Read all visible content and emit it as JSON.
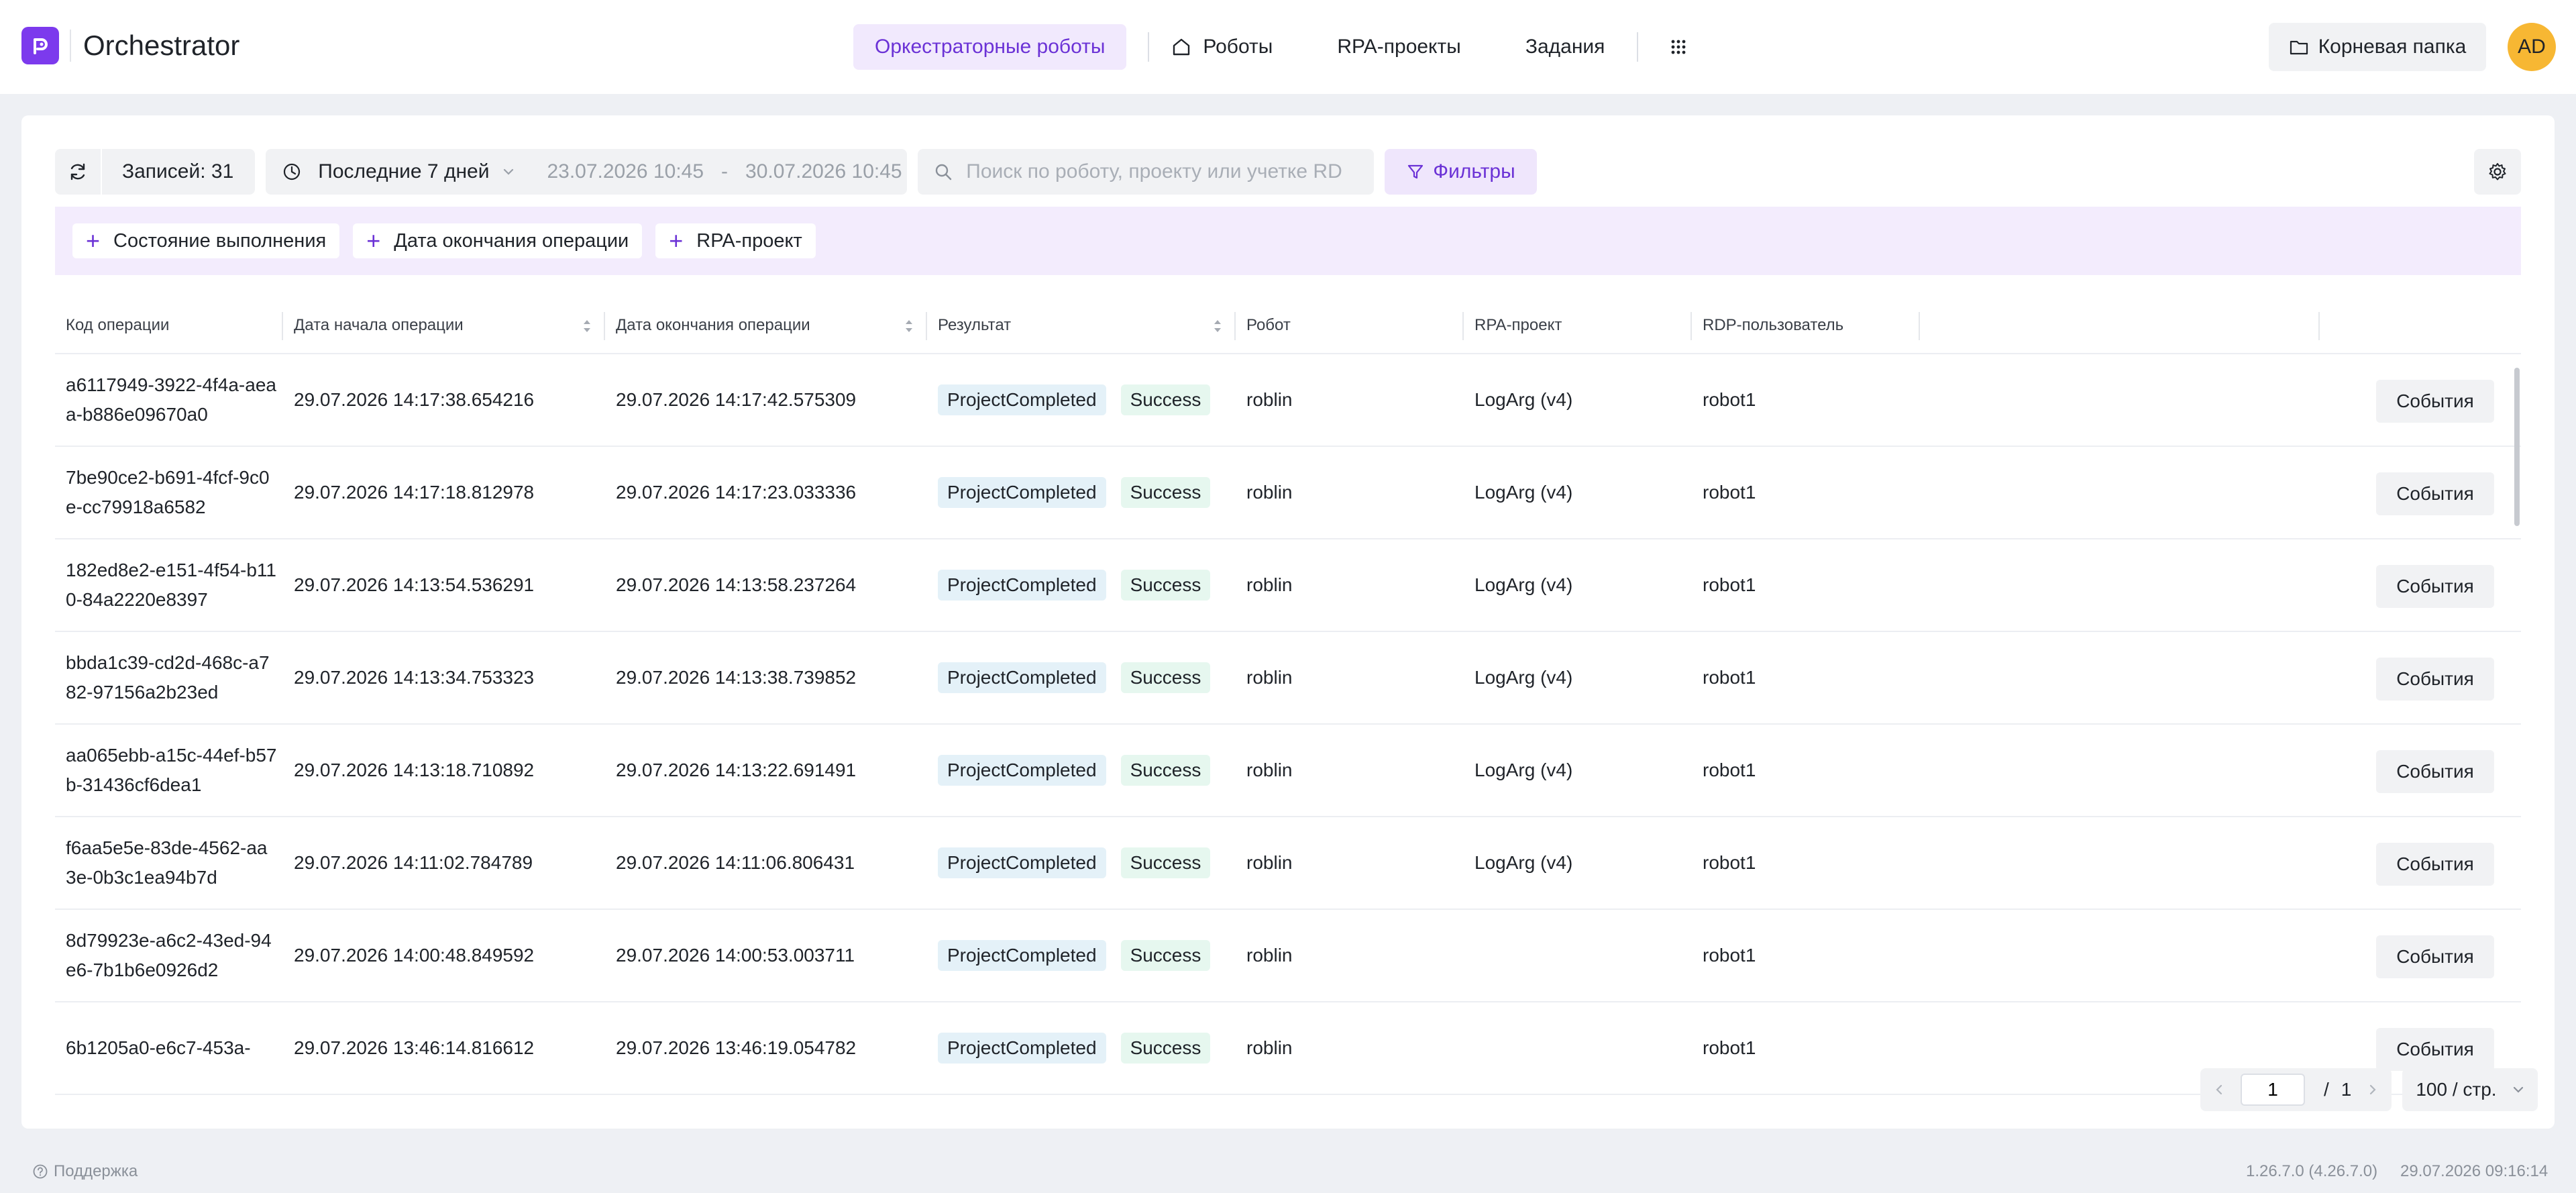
{
  "header": {
    "app_title": "Orchestrator",
    "nav_active": "Оркестраторные роботы",
    "nav_items": [
      "Роботы",
      "RPA-проекты",
      "Задания"
    ],
    "root_folder": "Корневая папка",
    "avatar_initials": "AD"
  },
  "toolbar": {
    "records": "Записей: 31",
    "range_label": "Последние 7 дней",
    "date_from": "23.07.2026 10:45",
    "date_to": "30.07.2026 10:45",
    "range_sep": "-",
    "search_placeholder": "Поиск по роботу, проекту или учетке RDP",
    "filters_label": "Фильтры"
  },
  "filter_chips": [
    "Состояние выполнения",
    "Дата окончания операции",
    "RPA-проект"
  ],
  "table": {
    "columns": [
      "Код операции",
      "Дата начала операции",
      "Дата окончания операции",
      "Результат",
      "Робот",
      "RPA-проект",
      "RDP-пользователь"
    ],
    "events_label": "События",
    "rows": [
      {
        "code": "a6117949-3922-4f4a-aeaa-b886e09670a0",
        "start": "29.07.2026 14:17:38.654216",
        "end": "29.07.2026 14:17:42.575309",
        "result": "ProjectCompleted",
        "status": "Success",
        "robot": "roblin",
        "project": "LogArg (v4)",
        "rdp": "robot1"
      },
      {
        "code": "7be90ce2-b691-4fcf-9c0e-cc79918a6582",
        "start": "29.07.2026 14:17:18.812978",
        "end": "29.07.2026 14:17:23.033336",
        "result": "ProjectCompleted",
        "status": "Success",
        "robot": "roblin",
        "project": "LogArg (v4)",
        "rdp": "robot1"
      },
      {
        "code": "182ed8e2-e151-4f54-b110-84a2220e8397",
        "start": "29.07.2026 14:13:54.536291",
        "end": "29.07.2026 14:13:58.237264",
        "result": "ProjectCompleted",
        "status": "Success",
        "robot": "roblin",
        "project": "LogArg (v4)",
        "rdp": "robot1"
      },
      {
        "code": "bbda1c39-cd2d-468c-a782-97156a2b23ed",
        "start": "29.07.2026 14:13:34.753323",
        "end": "29.07.2026 14:13:38.739852",
        "result": "ProjectCompleted",
        "status": "Success",
        "robot": "roblin",
        "project": "LogArg (v4)",
        "rdp": "robot1"
      },
      {
        "code": "aa065ebb-a15c-44ef-b57b-31436cf6dea1",
        "start": "29.07.2026 14:13:18.710892",
        "end": "29.07.2026 14:13:22.691491",
        "result": "ProjectCompleted",
        "status": "Success",
        "robot": "roblin",
        "project": "LogArg (v4)",
        "rdp": "robot1"
      },
      {
        "code": "f6aa5e5e-83de-4562-aa3e-0b3c1ea94b7d",
        "start": "29.07.2026 14:11:02.784789",
        "end": "29.07.2026 14:11:06.806431",
        "result": "ProjectCompleted",
        "status": "Success",
        "robot": "roblin",
        "project": "LogArg (v4)",
        "rdp": "robot1"
      },
      {
        "code": "8d79923e-a6c2-43ed-94e6-7b1b6e0926d2",
        "start": "29.07.2026 14:00:48.849592",
        "end": "29.07.2026 14:00:53.003711",
        "result": "ProjectCompleted",
        "status": "Success",
        "robot": "roblin",
        "project": "",
        "rdp": "robot1"
      },
      {
        "code": "6b1205a0-e6c7-453a-",
        "start": "29.07.2026 13:46:14.816612",
        "end": "29.07.2026 13:46:19.054782",
        "result": "ProjectCompleted",
        "status": "Success",
        "robot": "roblin",
        "project": "",
        "rdp": "robot1"
      }
    ]
  },
  "pager": {
    "page": "1",
    "slash": "/",
    "total": "1",
    "per_page": "100 / стр."
  },
  "footer": {
    "support": "Поддержка",
    "version": "1.26.7.0 (4.26.7.0)",
    "build_time": "29.07.2026 09:16:14"
  },
  "colors": {
    "accent": "#7c3aed",
    "accent_soft": "#f1e9fd",
    "result_tag": "#e4f1f8",
    "status_tag": "#e6f7ef",
    "avatar": "#f7b733"
  }
}
